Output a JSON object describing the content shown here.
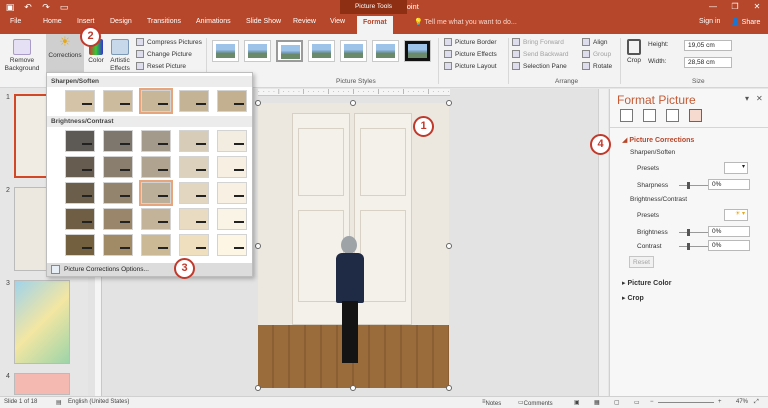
{
  "app": {
    "title": "Images - PowerPoint",
    "context_tab_group": "Picture Tools",
    "window_controls": [
      "—",
      "❐",
      "✕"
    ]
  },
  "quick_access": [
    "save",
    "undo",
    "redo",
    "start-from-beginning"
  ],
  "ribbon_tabs": [
    {
      "label": "File"
    },
    {
      "label": "Home"
    },
    {
      "label": "Insert"
    },
    {
      "label": "Design"
    },
    {
      "label": "Transitions"
    },
    {
      "label": "Animations"
    },
    {
      "label": "Slide Show"
    },
    {
      "label": "Review"
    },
    {
      "label": "View"
    },
    {
      "label": "Format"
    }
  ],
  "tell_me": "Tell me what you want to do...",
  "account": {
    "signin": "Sign in",
    "share": "Share"
  },
  "ribbon": {
    "remove_background": "Remove Background",
    "corrections": "Corrections",
    "color": "Color",
    "artistic_effects": "Artistic Effects",
    "compress": "Compress Pictures",
    "change": "Change Picture",
    "reset": "Reset Picture",
    "picture_styles_label": "Picture Styles",
    "picture_border": "Picture Border",
    "picture_effects": "Picture Effects",
    "picture_layout": "Picture Layout",
    "bring_forward": "Bring Forward",
    "send_backward": "Send Backward",
    "selection_pane": "Selection Pane",
    "align": "Align",
    "group": "Group",
    "rotate": "Rotate",
    "arrange_label": "Arrange",
    "crop": "Crop",
    "height_label": "Height:",
    "height_value": "19,05 cm",
    "width_label": "Width:",
    "width_value": "28,58 cm",
    "size_label": "Size"
  },
  "dropdown": {
    "sharpen_header": "Sharpen/Soften",
    "brightness_header": "Brightness/Contrast",
    "footer": "Picture Corrections Options..."
  },
  "slides": [
    "1",
    "2",
    "3",
    "4"
  ],
  "format_pane": {
    "title": "Format Picture",
    "section_corrections": "Picture Corrections",
    "sharpen_soften": "Sharpen/Soften",
    "presets1": "Presets",
    "sharpness": "Sharpness",
    "sharpness_value": "0%",
    "brightness_contrast": "Brightness/Contrast",
    "presets2": "Presets",
    "brightness": "Brightness",
    "brightness_value": "0%",
    "contrast": "Contrast",
    "contrast_value": "0%",
    "reset": "Reset",
    "picture_color": "Picture Color",
    "crop": "Crop"
  },
  "callouts": [
    "1",
    "2",
    "3",
    "4"
  ],
  "status": {
    "slide": "Slide 1 of 18",
    "language": "English (United States)",
    "notes": "Notes",
    "comments": "Comments",
    "zoom": "47%"
  },
  "colors": {
    "accent": "#b7472a",
    "callout": "#c0392b"
  }
}
